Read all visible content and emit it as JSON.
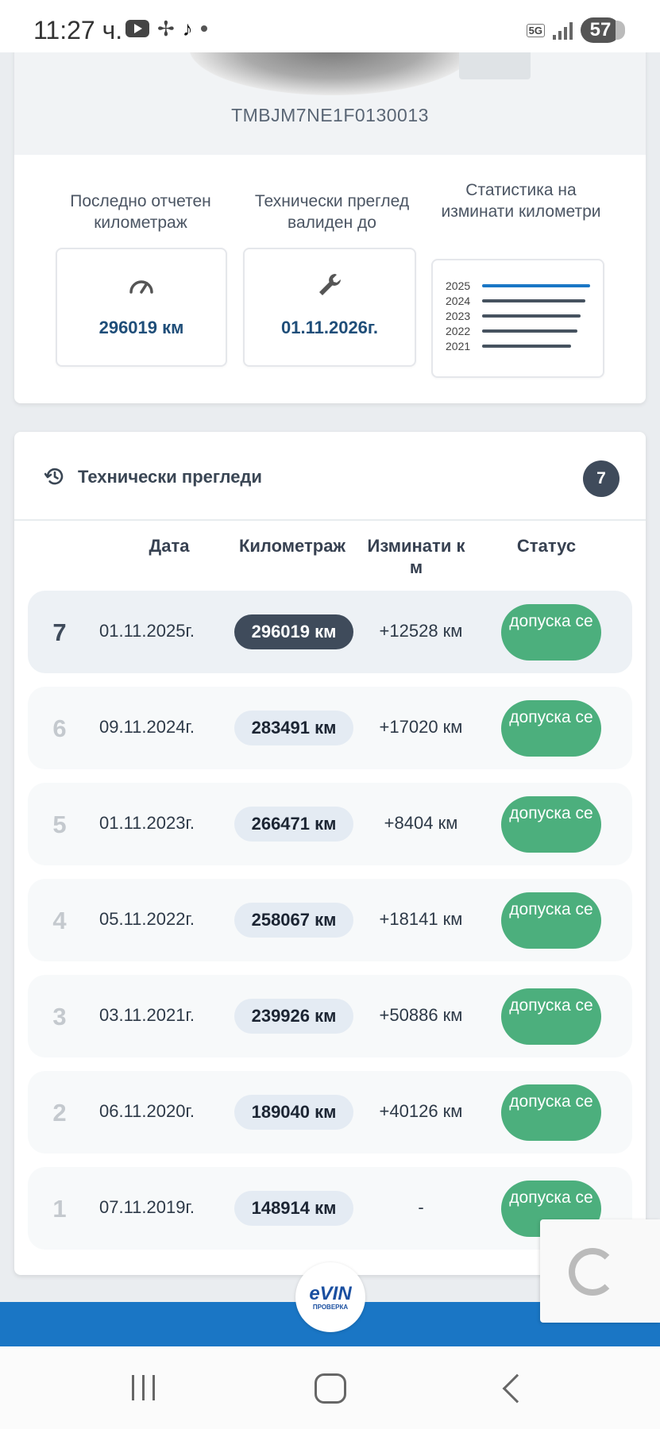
{
  "status_bar": {
    "time": "11:27 ч.",
    "network": "5G",
    "battery": "57"
  },
  "vehicle": {
    "vin": "TMBJM7NE1F0130013"
  },
  "stats": {
    "mileage_label": "Последно отчетен километраж",
    "mileage_value": "296019 км",
    "inspection_label": "Технически преглед валиден до",
    "inspection_value": "01.11.2026г.",
    "chart_label": "Статистика на изминати километри",
    "chart_years": [
      "2025",
      "2024",
      "2023",
      "2022",
      "2021"
    ]
  },
  "inspections": {
    "title": "Технически прегледи",
    "count": "7",
    "columns": {
      "date": "Дата",
      "mileage": "Километраж",
      "diff": "Изминати к м",
      "status": "Статус"
    },
    "rows": [
      {
        "num": "7",
        "date": "01.11.2025г.",
        "km": "296019 км",
        "diff": "+12528 км",
        "status": "допуска се"
      },
      {
        "num": "6",
        "date": "09.11.2024г.",
        "km": "283491 км",
        "diff": "+17020 км",
        "status": "допуска се"
      },
      {
        "num": "5",
        "date": "01.11.2023г.",
        "km": "266471 км",
        "diff": "+8404 км",
        "status": "допуска се"
      },
      {
        "num": "4",
        "date": "05.11.2022г.",
        "km": "258067 км",
        "diff": "+18141 км",
        "status": "допуска се"
      },
      {
        "num": "3",
        "date": "03.11.2021г.",
        "km": "239926 км",
        "diff": "+50886 км",
        "status": "допуска се"
      },
      {
        "num": "2",
        "date": "06.11.2020г.",
        "km": "189040 км",
        "diff": "+40126 км",
        "status": "допуска се"
      },
      {
        "num": "1",
        "date": "07.11.2019г.",
        "km": "148914 км",
        "diff": "-",
        "status": "допуска се"
      }
    ]
  },
  "footer": {
    "logo": "eVIN",
    "logo_sub": "ПРОВЕРКА"
  },
  "colors": {
    "accent_dark": "#3f4b5b",
    "status_green": "#4caf7d",
    "value_blue": "#1f4e79",
    "band_blue": "#1a76c5",
    "chart_highlight": "#1a76c5"
  }
}
